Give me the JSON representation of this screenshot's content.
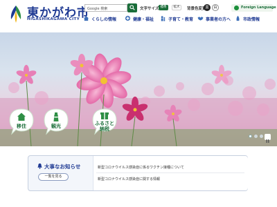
{
  "header": {
    "city_name": "東かがわ市",
    "city_name_en": "HIGASHIKAGAWA CITY",
    "search": {
      "placeholder": "Google 検索"
    },
    "font_size": {
      "label": "文字サイズ",
      "standard": "標準",
      "large": "拡大"
    },
    "color_change": {
      "label": "背景色変更",
      "black": "黒",
      "white": "白"
    },
    "language": {
      "label": "Foreign Language"
    },
    "nav": [
      {
        "label": "くらしの情報",
        "icon": "house-icon"
      },
      {
        "label": "健康・福祉",
        "icon": "health-icon"
      },
      {
        "label": "子育て・教育",
        "icon": "family-icon"
      },
      {
        "label": "事業者の方へ",
        "icon": "handshake-icon"
      },
      {
        "label": "市政情報",
        "icon": "city-hall-icon"
      }
    ]
  },
  "hero": {
    "quick_links": [
      {
        "label": "移住",
        "icon": "house-icon"
      },
      {
        "label": "観光",
        "icon": "lighthouse-icon"
      },
      {
        "label": "ふるさと",
        "label2": "納税",
        "icon": "gift-icon"
      }
    ],
    "slides": {
      "count": 3,
      "active": 1
    }
  },
  "news": {
    "title": "大事なお知らせ",
    "list_button": "一覧を見る",
    "items": [
      "新型コロナウイルス感染症に係るワクチン接種について",
      "新型コロナウイルス感染症に関する情報"
    ]
  },
  "colors": {
    "brand_blue": "#1f3a93",
    "brand_green": "#1b6e3a",
    "flower_pink": "#e46aa8"
  }
}
